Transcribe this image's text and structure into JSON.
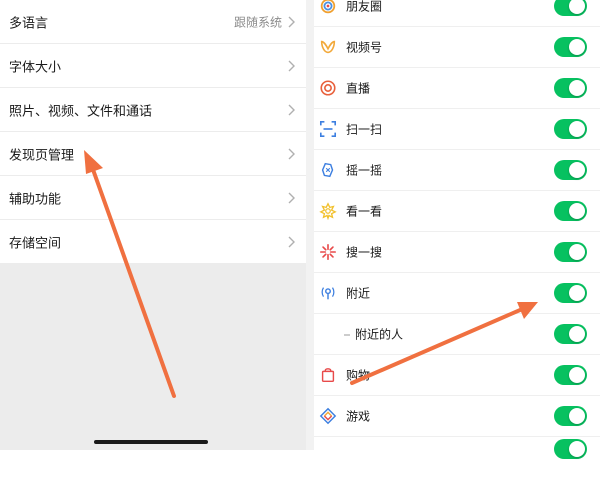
{
  "settings_list": {
    "items": [
      {
        "label": "多语言",
        "value": "跟随系统"
      },
      {
        "label": "字体大小",
        "value": ""
      },
      {
        "label": "照片、视频、文件和通话",
        "value": ""
      },
      {
        "label": "发现页管理",
        "value": ""
      },
      {
        "label": "辅助功能",
        "value": ""
      },
      {
        "label": "存储空间",
        "value": ""
      }
    ]
  },
  "discover_list": {
    "items": [
      {
        "label": "朋友圈",
        "icon": "moments-icon",
        "enabled": true
      },
      {
        "label": "视频号",
        "icon": "channels-icon",
        "enabled": true
      },
      {
        "label": "直播",
        "icon": "live-icon",
        "enabled": true
      },
      {
        "label": "扫一扫",
        "icon": "scan-icon",
        "enabled": true
      },
      {
        "label": "摇一摇",
        "icon": "shake-icon",
        "enabled": true
      },
      {
        "label": "看一看",
        "icon": "top-stories-icon",
        "enabled": true
      },
      {
        "label": "搜一搜",
        "icon": "search-icon",
        "enabled": true
      },
      {
        "label": "附近",
        "icon": "nearby-icon",
        "enabled": true
      },
      {
        "label": "附近的人",
        "icon": "",
        "enabled": true
      },
      {
        "label": "购物",
        "icon": "shopping-icon",
        "enabled": true
      },
      {
        "label": "游戏",
        "icon": "games-icon",
        "enabled": true
      }
    ]
  },
  "colors": {
    "toggle_on": "#07c160",
    "annotation_arrow": "#f07040",
    "left_background": "#ececec"
  }
}
